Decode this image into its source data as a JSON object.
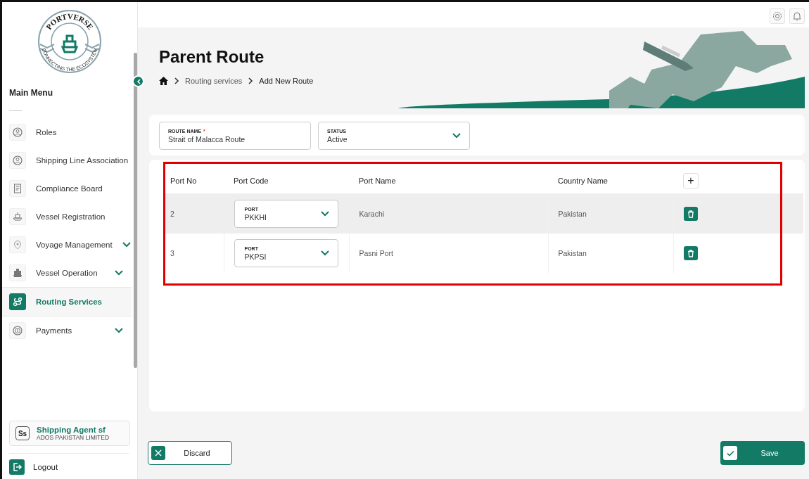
{
  "sidebar": {
    "logo": {
      "name": "PORTVERSE",
      "tagline": "CONNECTING THE ECOSYSTEM"
    },
    "menu_title": "Main Menu",
    "items": [
      {
        "label": "Roles",
        "kind": "roles",
        "selected": false,
        "expandable": false
      },
      {
        "label": "Shipping Line Association",
        "kind": "association",
        "selected": false,
        "expandable": false
      },
      {
        "label": "Compliance Board",
        "kind": "board",
        "selected": false,
        "expandable": false
      },
      {
        "label": "Vessel Registration",
        "kind": "vessel",
        "selected": false,
        "expandable": false
      },
      {
        "label": "Voyage Management",
        "kind": "voyage",
        "selected": false,
        "expandable": true
      },
      {
        "label": "Vessel Operation",
        "kind": "operation",
        "selected": false,
        "expandable": true
      },
      {
        "label": "Routing Services",
        "kind": "routing",
        "selected": true,
        "expandable": false
      },
      {
        "label": "Payments",
        "kind": "payments",
        "selected": false,
        "expandable": true
      }
    ],
    "user": {
      "initials": "Ss",
      "name": "Shipping Agent sf",
      "organization": "ADOS PAKISTAN LIMITED"
    },
    "logout": "Logout"
  },
  "header": {
    "title": "Parent Route",
    "breadcrumb": [
      "Routing services",
      "Add New Route"
    ]
  },
  "form": {
    "route_name": {
      "label": "ROUTE NAME",
      "required": true,
      "required_mark": "*",
      "value": "Strait of Malacca Route"
    },
    "status": {
      "label": "STATUS",
      "value": "Active"
    }
  },
  "table": {
    "columns": [
      "Port No",
      "Port Code",
      "Port Name",
      "Country Name"
    ],
    "add_button": "+",
    "rows": [
      {
        "port_no": "2",
        "port_label": "PORT",
        "port_code": "PKKHI",
        "port_name": "Karachi",
        "country": "Pakistan",
        "hovered": true
      },
      {
        "port_no": "3",
        "port_label": "PORT",
        "port_code": "PKPSI",
        "port_name": "Pasni Port",
        "country": "Pakistan",
        "hovered": false
      }
    ]
  },
  "actions": {
    "discard": "Discard",
    "save": "Save"
  }
}
